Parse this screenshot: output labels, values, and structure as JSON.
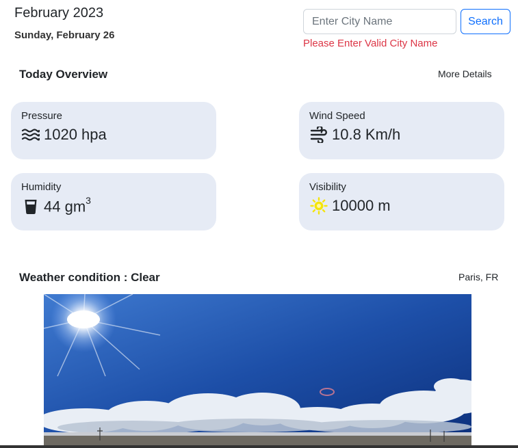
{
  "header": {
    "month_year": "February 2023",
    "full_date": "Sunday, February 26"
  },
  "search": {
    "placeholder": "Enter City Name",
    "value": "",
    "button_label": "Search",
    "error_message": "Please Enter Valid City Name"
  },
  "overview": {
    "title": "Today Overview",
    "more_link": "More Details",
    "cards": {
      "pressure": {
        "label": "Pressure",
        "value": "1020 hpa",
        "icon": "water-waves-icon"
      },
      "wind": {
        "label": "Wind Speed",
        "value": "10.8 Km/h",
        "icon": "wind-icon"
      },
      "humidity": {
        "label": "Humidity",
        "value": "44 gm",
        "superscript": "3",
        "icon": "cup-icon"
      },
      "visibility": {
        "label": "Visibility",
        "value": "10000 m",
        "icon": "sun-icon"
      }
    }
  },
  "condition": {
    "title": "Weather condition : Clear",
    "location": "Paris, FR",
    "image": "clear-sky-photo"
  },
  "colors": {
    "card_bg": "#e6ebf5",
    "accent_blue": "#0d6efd",
    "error_red": "#dc3545",
    "sun_yellow": "#f5e50a"
  }
}
